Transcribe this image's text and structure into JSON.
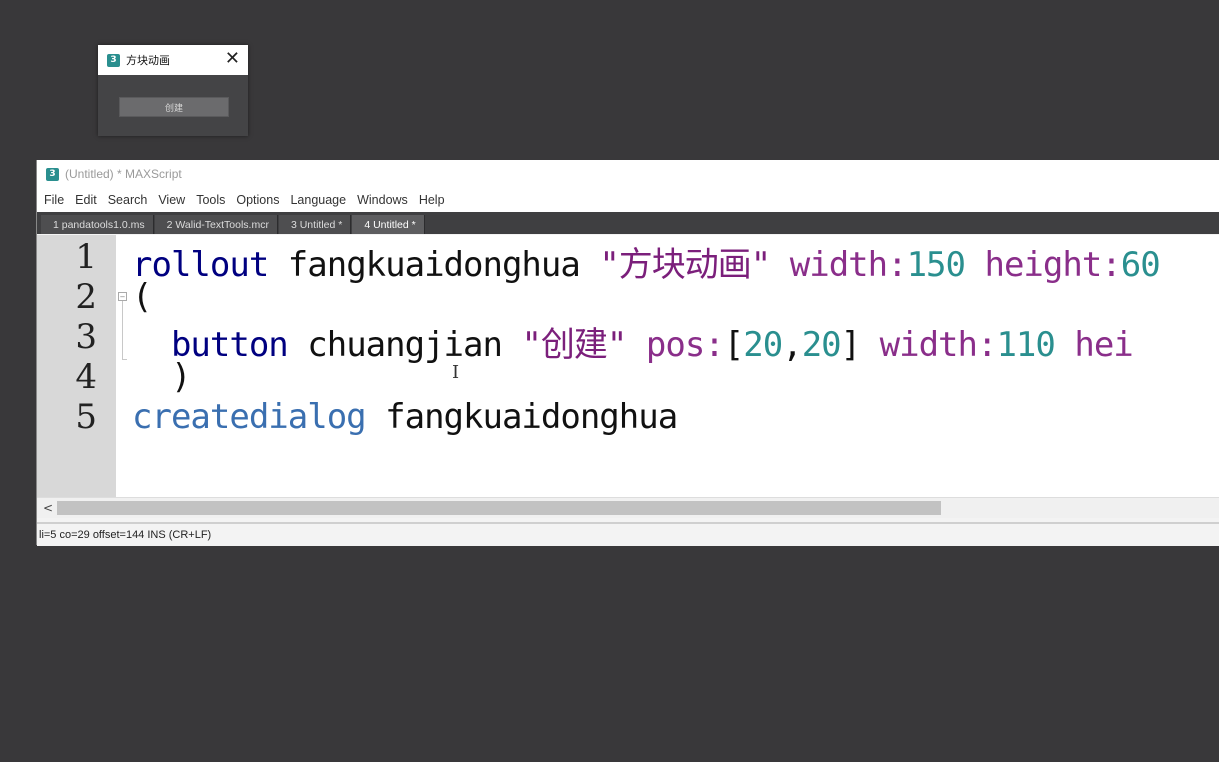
{
  "dialog": {
    "icon_glyph": "3",
    "title": "方块动画",
    "close_glyph": "✕",
    "button_label": "创建"
  },
  "editor": {
    "icon_glyph": "3",
    "title": "(Untitled) * MAXScript",
    "menu": [
      "File",
      "Edit",
      "Search",
      "View",
      "Tools",
      "Options",
      "Language",
      "Windows",
      "Help"
    ],
    "tabs": [
      {
        "label": "1 pandatools1.0.ms",
        "active": false
      },
      {
        "label": "2 Walid-TextTools.mcr",
        "active": false
      },
      {
        "label": "3 Untitled *",
        "active": false
      },
      {
        "label": "4 Untitled *",
        "active": true
      }
    ],
    "line_numbers": [
      "1",
      "2",
      "3",
      "4",
      "5"
    ],
    "code": {
      "l1": {
        "kw": "rollout",
        "name": "fangkuaidonghua",
        "str": "\"方块动画\"",
        "p1": "width:",
        "v1": "150",
        "p2": "height:",
        "v2": "60"
      },
      "l2": {
        "text": "("
      },
      "l3": {
        "kw": "button",
        "name": "chuangjian",
        "str": "\"创建\"",
        "p1": "pos:",
        "b1": "[",
        "n1": "20",
        "c": ",",
        "n2": "20",
        "b2": "]",
        "p2": "width:",
        "v2": "110",
        "p3": "hei"
      },
      "l4": {
        "text": ")"
      },
      "l5": {
        "fn": "createdialog",
        "name": "fangkuaidonghua"
      }
    },
    "fold_glyph": "−",
    "scroll_left_glyph": "<",
    "status": "li=5 co=29 offset=144 INS (CR+LF)"
  },
  "colors": {
    "background": "#39383a",
    "keyword": "#000080",
    "string": "#7b1f7b",
    "number": "#2a8f8f",
    "function": "#3a6fb0"
  }
}
